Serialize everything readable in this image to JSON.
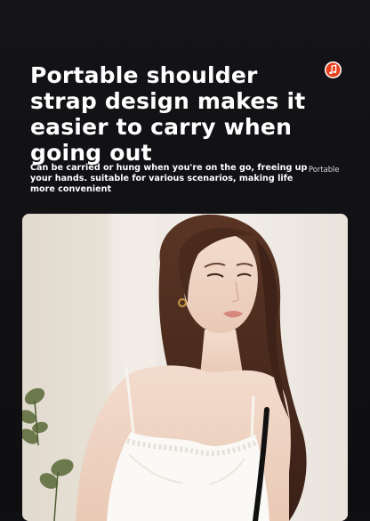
{
  "headline": "Portable shoulder strap design makes it easier to carry when going out",
  "description": "Can be carried or hung when you're on the go, freeing up your hands. suitable for various scenarios, making life more convenient",
  "side_tag": "Portable",
  "badge_icon": "music-note-icon",
  "photo": {
    "subject": "photo of a woman wearing a white lace camisole with a shoulder strap"
  },
  "colors": {
    "background": "#101013",
    "badge": "#e8401c",
    "text": "#ffffff"
  }
}
